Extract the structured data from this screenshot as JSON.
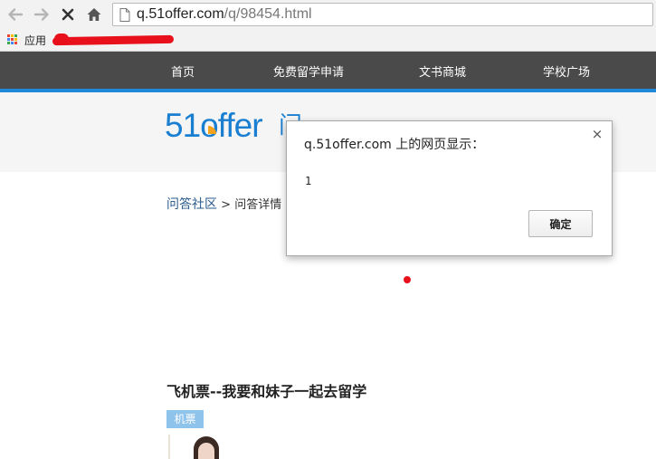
{
  "browser": {
    "url_host": "q.51offer.com",
    "url_path": "/q/98454.html",
    "bookmarks_apps_label": "应用"
  },
  "nav": {
    "items": [
      {
        "label": "首页"
      },
      {
        "label": "免费留学申请"
      },
      {
        "label": "文书商城"
      },
      {
        "label": "学校广场"
      }
    ]
  },
  "logo": {
    "text": "51offer",
    "sub_text": "问"
  },
  "breadcrumb": {
    "community": "问答社区",
    "separator": ">",
    "current": "问答详情"
  },
  "question": {
    "title": "飞机票--我要和妹子一起去留学",
    "tag": "机票"
  },
  "dialog": {
    "title": "q.51offer.com 上的网页显示：",
    "message": "1",
    "ok_label": "确定",
    "close_symbol": "×"
  },
  "colors": {
    "nav_bg": "#4a4a4a",
    "accent_blue": "#1e88d9",
    "logo_orange": "#f5a31c",
    "tag_bg": "#8ec3ec"
  }
}
